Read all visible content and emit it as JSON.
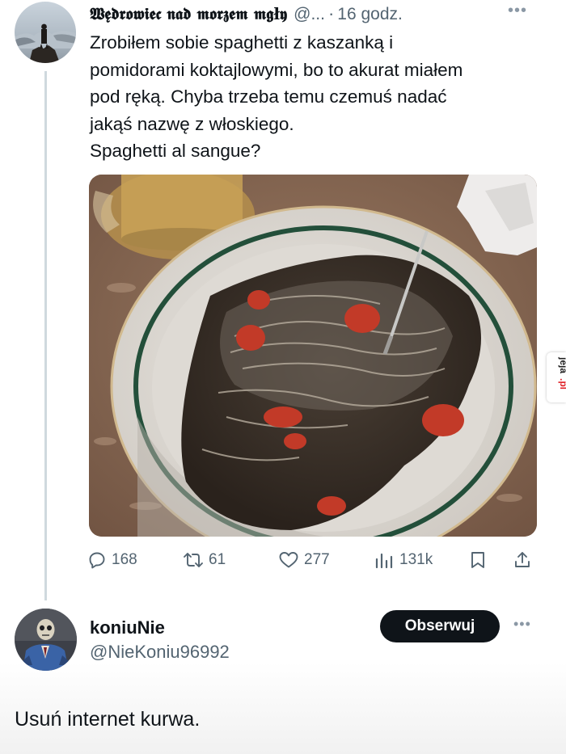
{
  "tweet": {
    "author_name": "𝖂𝖊̨𝖉𝖗𝖔𝖜𝖎𝖊𝖈 𝖓𝖆𝖉 𝖒𝖔𝖗𝖟𝖊𝖒 𝖒𝖌ł𝖞",
    "handle": "@...",
    "separator": "·",
    "time": "16 godz.",
    "more_label": "•••",
    "text_lines": [
      "Zrobiłem sobie spaghetti z kaszanką i",
      "pomidorami koktajlowymi, bo to akurat miałem",
      "pod ręką. Chyba trzeba temu czemuś nadać",
      "jakąś nazwę z włoskiego.",
      "Spaghetti al sangue?"
    ],
    "actions": {
      "replies": "168",
      "reposts": "61",
      "likes": "277",
      "views": "131k"
    }
  },
  "reply": {
    "author_name": "koniuNie",
    "handle": "@NieKoniu96992",
    "follow_label": "Obserwuj",
    "more_label": "•••",
    "text": "Usuń internet kurwa."
  },
  "watermark": "jeja.pl",
  "colors": {
    "text_primary": "#0f1419",
    "text_secondary": "#536471",
    "thread_line": "#cfd9de",
    "follow_bg": "#0f1419",
    "watermark_red": "#e0242b"
  },
  "icons": [
    "reply-icon",
    "repost-icon",
    "like-icon",
    "views-icon",
    "bookmark-icon",
    "share-icon"
  ]
}
